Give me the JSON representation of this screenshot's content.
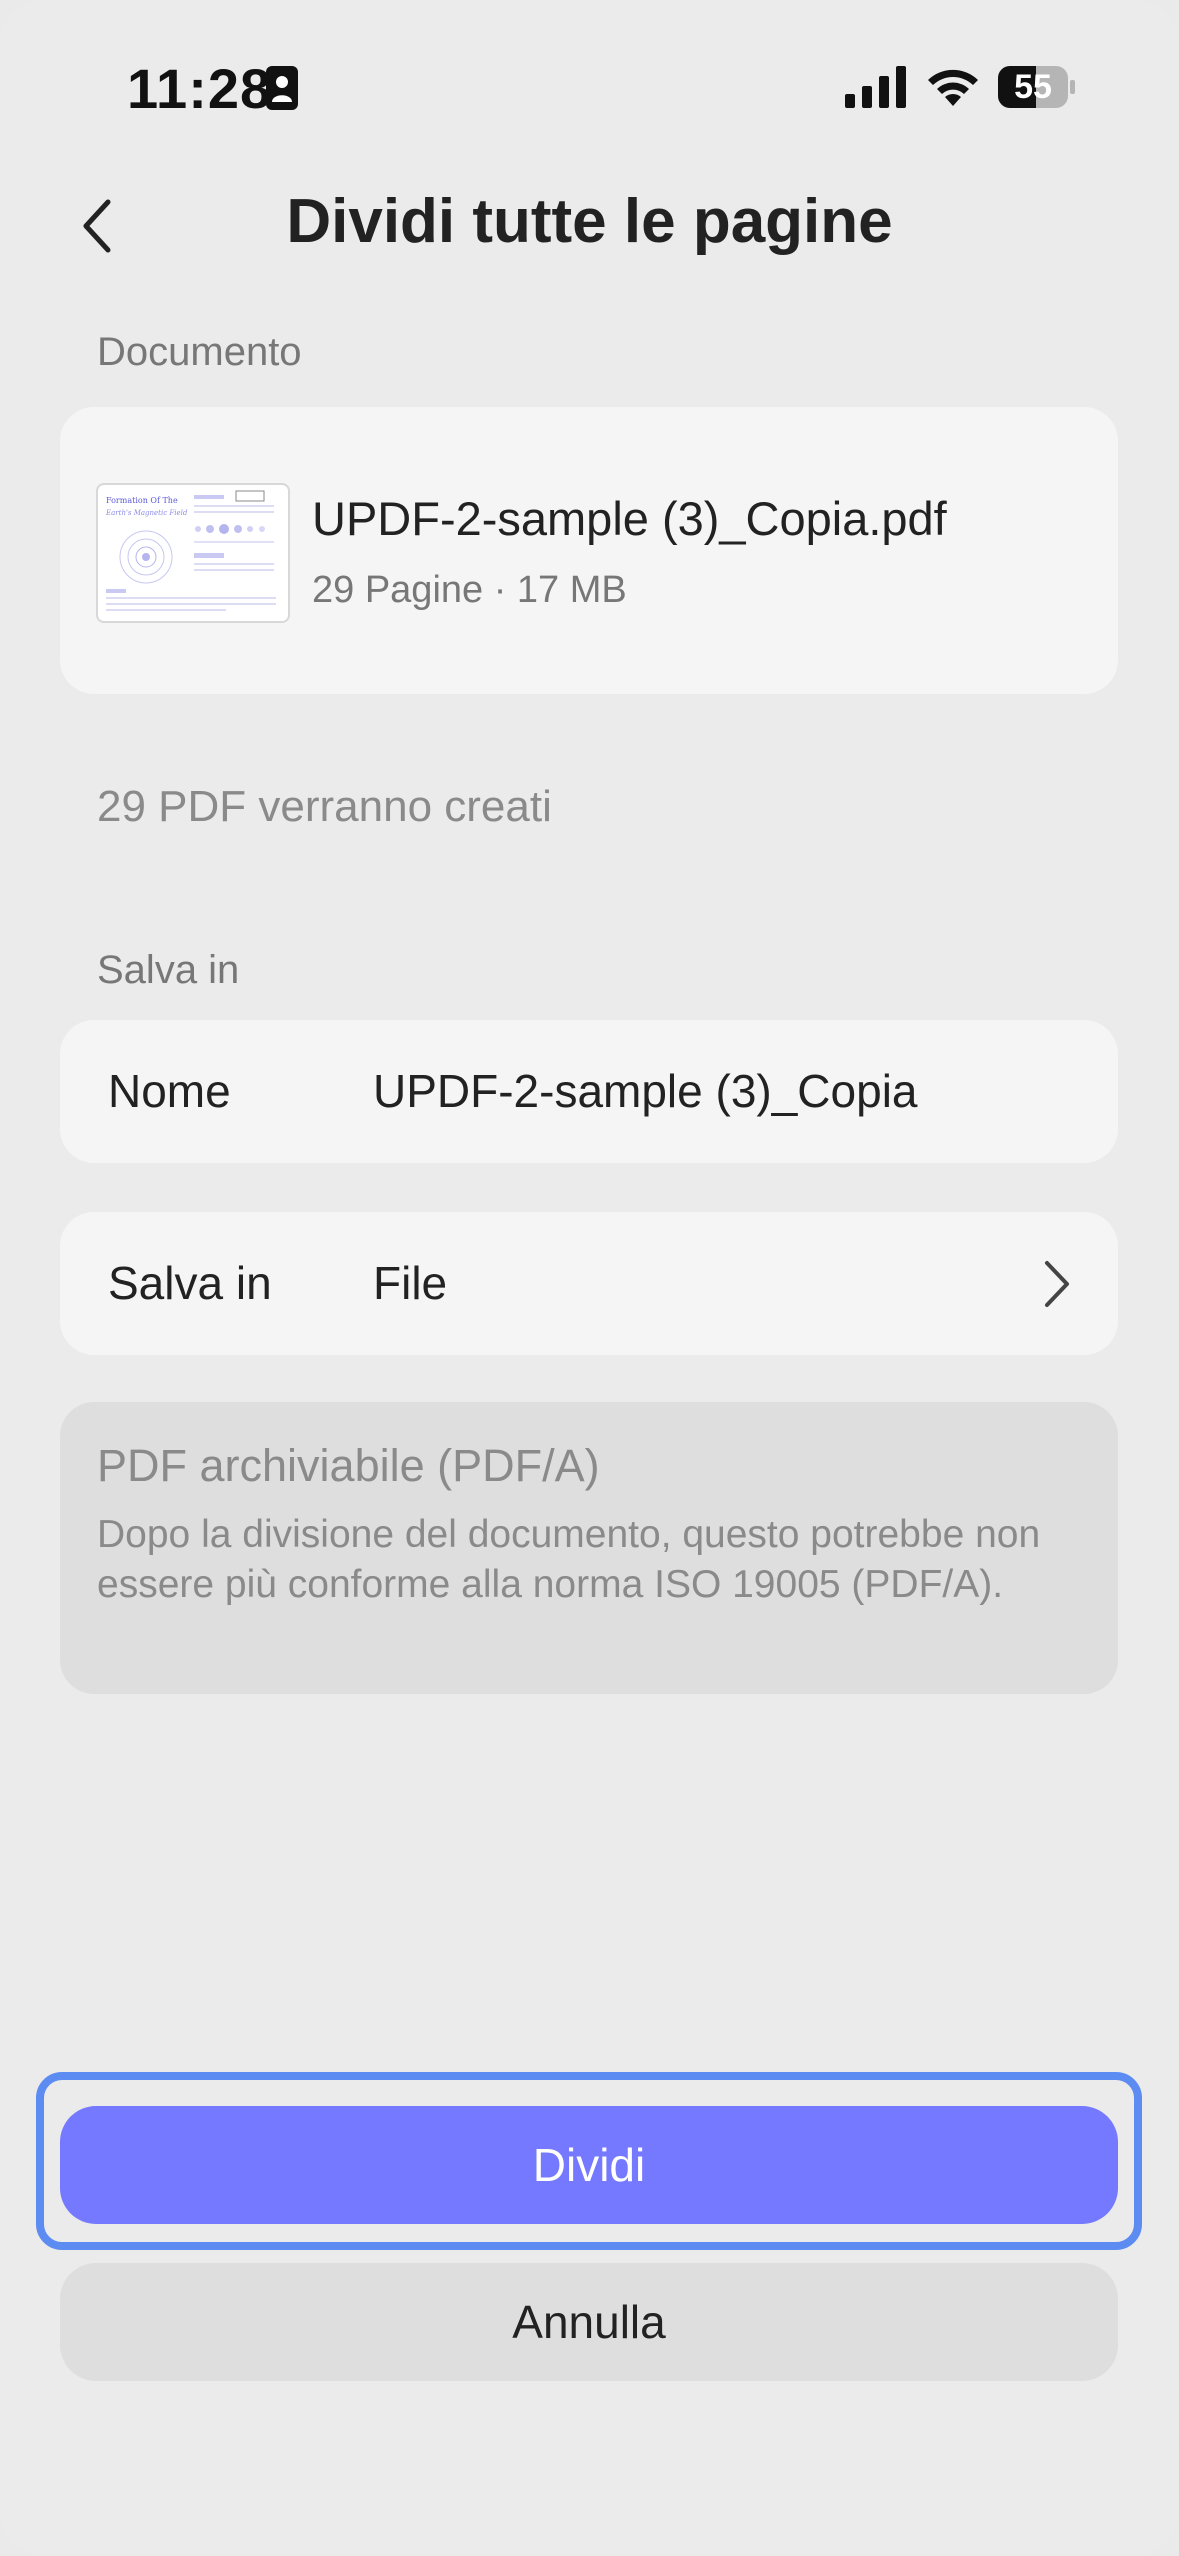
{
  "status_bar": {
    "time": "11:28",
    "battery": "55",
    "icons": [
      "id-card-icon",
      "cellular-signal-icon",
      "wifi-icon",
      "battery-icon"
    ]
  },
  "header": {
    "title": "Dividi tutte le pagine",
    "back_icon": "chevron-left-icon"
  },
  "document": {
    "section_label": "Documento",
    "file_name": "UPDF-2-sample (3)_Copia.pdf",
    "meta": "29 Pagine · 17 MB",
    "thumbnail": {
      "title_line1": "Formation Of The",
      "title_line2": "Earth's Magnetic Field"
    }
  },
  "result_summary": "29 PDF verranno creati",
  "save": {
    "section_label": "Salva in",
    "name_row": {
      "label": "Nome",
      "value": "UPDF-2-sample (3)_Copia"
    },
    "location_row": {
      "label": "Salva in",
      "value": "File",
      "icon": "chevron-right-icon"
    }
  },
  "pdfa": {
    "title": "PDF archiviabile (PDF/A)",
    "description": "Dopo la divisione del documento, questo potrebbe non essere più conforme alla norma ISO 19005 (PDF/A)."
  },
  "actions": {
    "primary_label": "Dividi",
    "secondary_label": "Annulla"
  },
  "colors": {
    "background": "#ebebeb",
    "card": "#f5f5f5",
    "primary": "#7479ff",
    "focus_ring": "#5c8bf2",
    "disabled_card": "#dedede"
  }
}
